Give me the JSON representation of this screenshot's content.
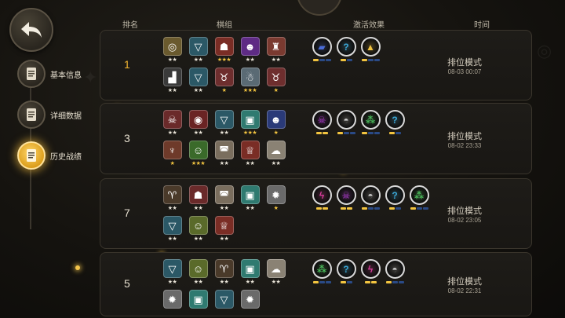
{
  "nav": {
    "items": [
      {
        "label": "基本信息",
        "icon": "document-icon",
        "active": false
      },
      {
        "label": "详细数据",
        "icon": "info-document-icon",
        "active": false
      },
      {
        "label": "历史战绩",
        "icon": "history-document-icon",
        "active": true
      }
    ]
  },
  "header": {
    "col_rank": "排名",
    "col_lineup": "棋组",
    "col_synergy": "激活效果",
    "col_time": "时间"
  },
  "colors": {
    "gold": "#f2c440",
    "rank_first": "#f2b632",
    "bar_inactive": "#2a4a86"
  },
  "matches": [
    {
      "rank": "1",
      "mode": "排位模式",
      "time": "08-03 00:07",
      "units": [
        {
          "icon": "yellow-goggles-icon",
          "bg": "#6a5a2e",
          "stars": "★★",
          "gold": false
        },
        {
          "icon": "teal-v-icon",
          "bg": "#2b5866",
          "stars": "★★",
          "gold": false
        },
        {
          "icon": "red-beast-icon",
          "bg": "#7a2d25",
          "stars": "★★★",
          "gold": true
        },
        {
          "icon": "purple-hair-icon",
          "bg": "#5e2b84",
          "stars": "★★",
          "gold": false
        },
        {
          "icon": "red-helmet-icon",
          "bg": "#7a3a30",
          "stars": "★★",
          "gold": false
        },
        {
          "icon": "dark-graph-icon",
          "bg": "#3a3a3a",
          "stars": "★★",
          "gold": false
        },
        {
          "icon": "teal-v-icon",
          "bg": "#2b5866",
          "stars": "★★",
          "gold": false
        },
        {
          "icon": "red-horned-icon",
          "bg": "#6e2e2e",
          "stars": "★",
          "gold": true
        },
        {
          "icon": "white-yeti-icon",
          "bg": "#5a6a74",
          "stars": "★★★",
          "gold": true
        },
        {
          "icon": "red-horned-icon",
          "bg": "#6e2e2e",
          "stars": "★",
          "gold": true
        }
      ],
      "synergies": [
        {
          "icon": "shield-icon",
          "color": "#4a6cd8",
          "segs": 3,
          "on": 1
        },
        {
          "icon": "question-icon",
          "color": "#39a6d6",
          "segs": 2,
          "on": 1
        },
        {
          "icon": "triangle-icon",
          "color": "#f2c440",
          "segs": 3,
          "on": 1
        }
      ]
    },
    {
      "rank": "3",
      "mode": "排位模式",
      "time": "08-02 23:33",
      "units": [
        {
          "icon": "red-skull-icon",
          "bg": "#6a2a2a",
          "stars": "★★",
          "gold": false
        },
        {
          "icon": "red-eyes-icon",
          "bg": "#6a2424",
          "stars": "★★",
          "gold": false
        },
        {
          "icon": "teal-helmet-icon",
          "bg": "#2b5866",
          "stars": "★★",
          "gold": false
        },
        {
          "icon": "teal-robot-icon",
          "bg": "#2f7a70",
          "stars": "★★★",
          "gold": true
        },
        {
          "icon": "blue-ogre-icon",
          "bg": "#2a3a78",
          "stars": "★",
          "gold": true
        },
        {
          "icon": "red-antler-icon",
          "bg": "#6e3a2a",
          "stars": "★",
          "gold": true
        },
        {
          "icon": "green-goblin-icon",
          "bg": "#3a6a2a",
          "stars": "★★★",
          "gold": true
        },
        {
          "icon": "white-hat-icon",
          "bg": "#7a6e5e",
          "stars": "★★",
          "gold": false
        },
        {
          "icon": "red-tophat-icon",
          "bg": "#7a2d25",
          "stars": "★★",
          "gold": false
        },
        {
          "icon": "sheep-icon",
          "bg": "#8a8274",
          "stars": "★★",
          "gold": false
        }
      ],
      "synergies": [
        {
          "icon": "skull-icon",
          "color": "#b13ad6",
          "segs": 2,
          "on": 2
        },
        {
          "icon": "helmet-icon",
          "color": "#c8c8c8",
          "segs": 3,
          "on": 1
        },
        {
          "icon": "trio-icon",
          "color": "#49b85a",
          "segs": 3,
          "on": 1
        },
        {
          "icon": "question-icon",
          "color": "#39a6d6",
          "segs": 2,
          "on": 1
        }
      ]
    },
    {
      "rank": "7",
      "mode": "排位模式",
      "time": "08-02 23:05",
      "units": [
        {
          "icon": "green-horn-icon",
          "bg": "#4a3a2a",
          "stars": "★★",
          "gold": false
        },
        {
          "icon": "red-beast-icon",
          "bg": "#6a2a2a",
          "stars": "★★",
          "gold": false
        },
        {
          "icon": "white-hat-icon",
          "bg": "#7a6e5e",
          "stars": "★★",
          "gold": false
        },
        {
          "icon": "teal-robot-icon",
          "bg": "#2f7a70",
          "stars": "★★",
          "gold": false
        },
        {
          "icon": "white-spike-icon",
          "bg": "#6a6a6a",
          "stars": "★",
          "gold": true
        },
        {
          "icon": "teal-v-icon",
          "bg": "#2b5866",
          "stars": "★★",
          "gold": false
        },
        {
          "icon": "yellow-goblin-icon",
          "bg": "#5a6a2a",
          "stars": "★★",
          "gold": false
        },
        {
          "icon": "red-tophat-icon",
          "bg": "#7a2d25",
          "stars": "★★",
          "gold": false
        }
      ],
      "synergies": [
        {
          "icon": "bolt-icon",
          "color": "#d63a9a",
          "segs": 2,
          "on": 2
        },
        {
          "icon": "skull-icon",
          "color": "#b13ad6",
          "segs": 2,
          "on": 2
        },
        {
          "icon": "helmet-icon",
          "color": "#c8c8c8",
          "segs": 3,
          "on": 1
        },
        {
          "icon": "question-icon",
          "color": "#39a6d6",
          "segs": 2,
          "on": 1
        },
        {
          "icon": "trio-icon",
          "color": "#49b85a",
          "segs": 3,
          "on": 1
        }
      ]
    },
    {
      "rank": "5",
      "mode": "排位模式",
      "time": "08-02 22:31",
      "units": [
        {
          "icon": "teal-v-icon",
          "bg": "#2b5866",
          "stars": "★★",
          "gold": false
        },
        {
          "icon": "yellow-goblin-icon",
          "bg": "#5a6a2a",
          "stars": "★★",
          "gold": false
        },
        {
          "icon": "green-horn-icon",
          "bg": "#4a3a2a",
          "stars": "★★",
          "gold": false
        },
        {
          "icon": "teal-robot-icon",
          "bg": "#2f7a70",
          "stars": "★★",
          "gold": false
        },
        {
          "icon": "sheep-icon",
          "bg": "#8a8274",
          "stars": "★★",
          "gold": false
        },
        {
          "icon": "white-spike-icon",
          "bg": "#6a6a6a",
          "stars": "",
          "gold": false
        },
        {
          "icon": "teal-robot-icon",
          "bg": "#2f7a70",
          "stars": "",
          "gold": false
        },
        {
          "icon": "teal-v-icon",
          "bg": "#2b5866",
          "stars": "",
          "gold": false
        },
        {
          "icon": "white-spike-icon",
          "bg": "#6a6a6a",
          "stars": "",
          "gold": false
        }
      ],
      "synergies": [
        {
          "icon": "trio-icon",
          "color": "#49b85a",
          "segs": 3,
          "on": 1
        },
        {
          "icon": "question-icon",
          "color": "#39a6d6",
          "segs": 2,
          "on": 1
        },
        {
          "icon": "bolt-icon",
          "color": "#d63a9a",
          "segs": 2,
          "on": 2
        },
        {
          "icon": "helmet-icon",
          "color": "#c8c8c8",
          "segs": 3,
          "on": 1
        }
      ]
    }
  ]
}
